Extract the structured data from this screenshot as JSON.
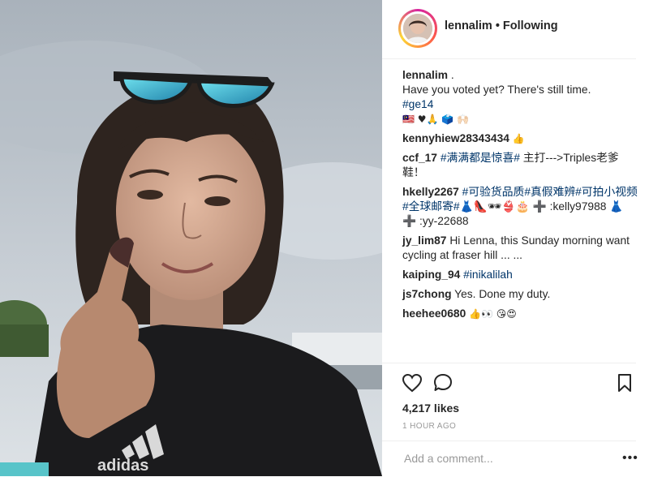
{
  "post": {
    "username": "lennalim",
    "follow_status": "Following",
    "separator": "•"
  },
  "caption": {
    "username": "lennalim",
    "text_1": ".",
    "line_2": "Have you voted yet? There's still time.",
    "hashtag": "#ge14",
    "emoji_line": "🇲🇾 ♥🙏 🗳️ 🙌🏻"
  },
  "comments": [
    {
      "username": "kennyhiew28343434",
      "text": "👍"
    },
    {
      "username": "ccf_17",
      "tag": "#满满都是惊喜#",
      "text": " 主打--->Triples老爹鞋！"
    },
    {
      "username": "hkelly2267",
      "tag": "#可验货品质#真假难辨#可拍小视频#全球邮寄#",
      "text": "👗👠🕶👙🎂 ➕ :kelly97988 👗 ➕ :yy-22688"
    },
    {
      "username": "jy_lim87",
      "text": "Hi Lenna, this Sunday morning want cycling at fraser hill ... ..."
    },
    {
      "username": "kaiping_94",
      "tag": "#inikalilah",
      "text": ""
    },
    {
      "username": "js7chong",
      "text": "Yes. Done my duty."
    },
    {
      "username": "heehee0680",
      "text": "👍👀 😘😍"
    }
  ],
  "actions": {
    "likes": "4,217 likes",
    "timestamp": "1 HOUR AGO",
    "comment_placeholder": "Add a comment...",
    "more": "•••"
  },
  "icons": [
    "heart-icon",
    "comment-icon",
    "bookmark-icon",
    "more-options-icon"
  ]
}
